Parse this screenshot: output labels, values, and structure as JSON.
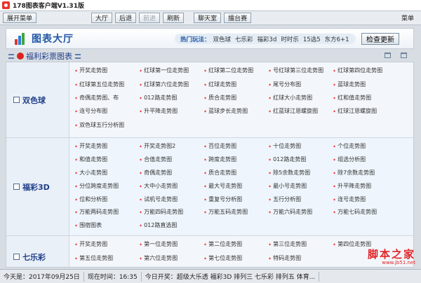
{
  "window": {
    "title": "178图表客户端V1.31版"
  },
  "toolbar": {
    "expand_label": "展开菜单",
    "buttons": [
      "大厅",
      "后退",
      "前进",
      "刷新"
    ],
    "extra": [
      "聊天室",
      "擂台赛"
    ],
    "menu_label": "菜单"
  },
  "header": {
    "logo_text": "图表大厅",
    "hot_label": "热门玩法：",
    "hot_items": [
      "双色球",
      "七乐彩",
      "福彩3d",
      "时时乐",
      "15选5",
      "东方6+1"
    ],
    "update_label": "检查更新"
  },
  "section": {
    "title": "福利彩票图表"
  },
  "lotteries": [
    {
      "name": "双色球",
      "links": [
        "开奖走势图",
        "红球第一位走势图",
        "红球第二位走势图",
        "号红球第三位走势图",
        "红球第四位走势图",
        "红球第五位走势图",
        "红球第六位走势图",
        "红球走势图",
        "尾号分布图",
        "蓝球走势图",
        "奇偶走势图、布",
        "012路走势图",
        "质合走势图",
        "红球大小走势图",
        "红和值走势图",
        "连号分布图",
        "升平降走势图",
        "蓝球步长走势图",
        "红蓝球江恩螺旋图",
        "红球江恩螺旋图",
        "双色球五行分析图"
      ]
    },
    {
      "name": "福彩3D",
      "links": [
        "开奖走势图",
        "开奖走势图2",
        "百位走势图",
        "十位走势图",
        "个位走势图",
        "和值走势图",
        "合值走势图",
        "跨度走势图",
        "012路走势图",
        "组选分析图",
        "大小走势图",
        "奇偶走势图",
        "质合走势图",
        "除5余数走势图",
        "除7余数走势图",
        "分位跨度走势图",
        "大中小走势图",
        "最大号走势图",
        "最小号走势图",
        "升平降走势图",
        "位和分析图",
        "试机号走势图",
        "重复号分析图",
        "五行分析图",
        "连号走势图",
        "万能两码走势图",
        "万能四码走势图",
        "万能五码走势图",
        "万能六码走势图",
        "万能七码走势图",
        "围宿图表",
        "012路直选图"
      ]
    },
    {
      "name": "七乐彩",
      "links": [
        "开奖走势图",
        "第一位走势图",
        "第二位走势图",
        "第三位走势图",
        "第四位走势图",
        "第五位走势图",
        "第六位走势图",
        "第七位走势图",
        "特码走势图",
        ""
      ]
    }
  ],
  "watermark": {
    "line1": "脚本之家",
    "line2": "www.jb51.net"
  },
  "status": {
    "today_label": "今天是：2017年09月25日",
    "time_label": "现在时间：16:35",
    "draw_label": "今日开奖：超级大乐透 福彩3D 排列三 七乐彩 排列五 体育..."
  }
}
